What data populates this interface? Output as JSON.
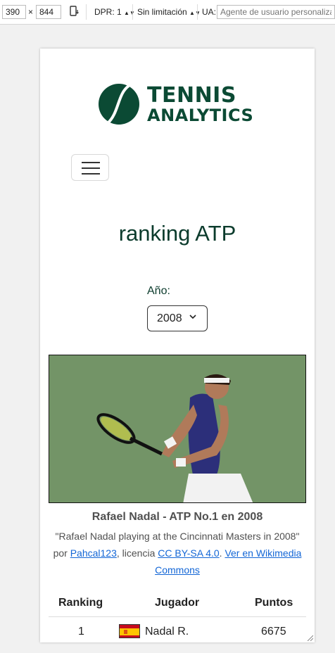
{
  "devtools": {
    "width": "390",
    "times": "×",
    "height": "844",
    "dpr_label": "DPR: 1",
    "throttle_label": "Sin limitación",
    "ua_label": "UA:",
    "ua_placeholder": "Agente de usuario personalizado"
  },
  "brand": {
    "line1": "TENNIS",
    "line2": "ANALYTICS",
    "color": "#0b4a34"
  },
  "page": {
    "title": "ranking ATP",
    "year_label": "Año:",
    "year_selected": "2008"
  },
  "photo": {
    "caption": "Rafael Nadal - ATP No.1 en 2008",
    "description_quote": "\"Rafael Nadal playing at the Cincinnati Masters in 2008\"",
    "by": "por",
    "author": "Pahcal123",
    "license_prefix": ", licencia",
    "license": "CC BY-SA 4.0",
    "period": ".",
    "wikimedia_link": "Ver en Wikimedia Commons"
  },
  "table": {
    "headers": [
      "Ranking",
      "Jugador",
      "Puntos"
    ],
    "rows": [
      {
        "ranking": "1",
        "player": "Nadal R.",
        "points": "6675",
        "flag": "spain-flag"
      }
    ]
  },
  "colors": {
    "link": "#1366d6",
    "heading": "#0b3b2c"
  }
}
